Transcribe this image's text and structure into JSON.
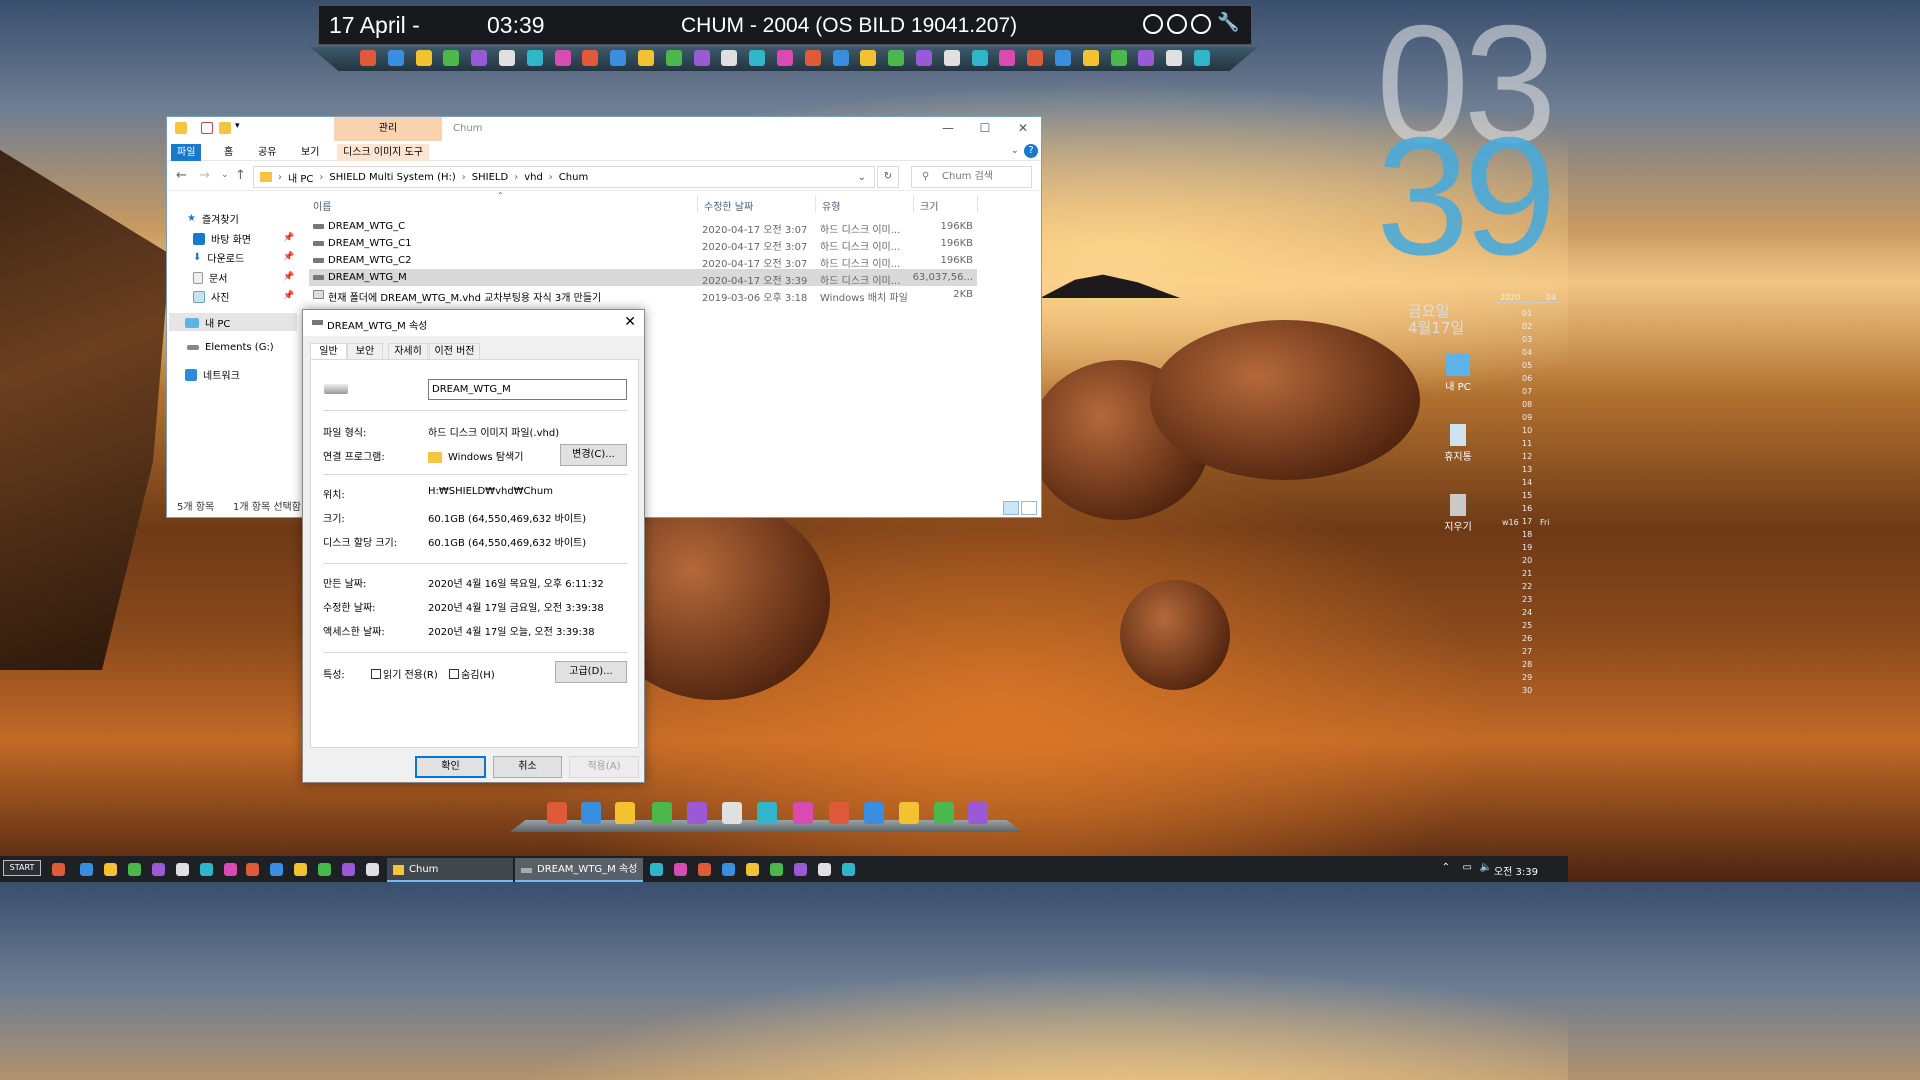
{
  "topbar": {
    "date": "17 April -",
    "time": "03:39",
    "title": "CHUM - 2004 (OS BILD 19041.207)"
  },
  "desktop": {
    "clock_hour": "03",
    "clock_minute": "39",
    "weekday": "금요일",
    "date": "4월17일",
    "calendar_year": "2020",
    "calendar_month": "04",
    "calendar_days": [
      "01",
      "02",
      "03",
      "04",
      "05",
      "06",
      "07",
      "08",
      "09",
      "10",
      "11",
      "12",
      "13",
      "14",
      "15",
      "16",
      "17",
      "18",
      "19",
      "20",
      "21",
      "22",
      "23",
      "24",
      "25",
      "26",
      "27",
      "28",
      "29",
      "30"
    ],
    "week_label": "w16",
    "today_day": "Fri",
    "icons": [
      {
        "label": "내 PC",
        "icon": "computer-icon"
      },
      {
        "label": "휴지통",
        "icon": "recycle-bin-icon"
      },
      {
        "label": "지우기",
        "icon": "broom-icon"
      }
    ]
  },
  "explorer": {
    "title": "Chum",
    "context_tab": "관리",
    "ribbon_tabs": [
      "파일",
      "홈",
      "공유",
      "보기",
      "디스크 이미지 도구"
    ],
    "breadcrumb": [
      "내 PC",
      "SHIELD Multi System (H:)",
      "SHIELD",
      "vhd",
      "Chum"
    ],
    "search_placeholder": "Chum 검색",
    "nav": {
      "quick_access": "즐겨찾기",
      "items": [
        "바탕 화면",
        "다운로드",
        "문서",
        "사진"
      ],
      "this_pc": "내 PC",
      "drive": "Elements (G:)",
      "network": "네트워크"
    },
    "columns": [
      "이름",
      "수정한 날짜",
      "유형",
      "크기"
    ],
    "files": [
      {
        "name": "DREAM_WTG_C",
        "date": "2020-04-17 오전 3:07",
        "type": "하드 디스크 이미...",
        "size": "196KB"
      },
      {
        "name": "DREAM_WTG_C1",
        "date": "2020-04-17 오전 3:07",
        "type": "하드 디스크 이미...",
        "size": "196KB"
      },
      {
        "name": "DREAM_WTG_C2",
        "date": "2020-04-17 오전 3:07",
        "type": "하드 디스크 이미...",
        "size": "196KB"
      },
      {
        "name": "DREAM_WTG_M",
        "date": "2020-04-17 오전 3:39",
        "type": "하드 디스크 이미...",
        "size": "63,037,56..."
      },
      {
        "name": "현재 폴더에 DREAM_WTG_M.vhd 교차부팅용 자식 3개 만들기",
        "date": "2019-03-06 오후 3:18",
        "type": "Windows 배치 파일",
        "size": "2KB"
      }
    ],
    "status_count": "5개 항목",
    "status_selected": "1개 항목 선택함"
  },
  "properties": {
    "title": "DREAM_WTG_M 속성",
    "tabs": [
      "일반",
      "보안",
      "자세히",
      "이전 버전"
    ],
    "name_value": "DREAM_WTG_M",
    "file_type_label": "파일 형식:",
    "file_type_value": "하드 디스크 이미지 파일(.vhd)",
    "open_with_label": "연결 프로그램:",
    "open_with_value": "Windows 탐색기",
    "change_button": "변경(C)...",
    "location_label": "위치:",
    "location_value": "H:₩SHIELD₩vhd₩Chum",
    "size_label": "크기:",
    "size_value": "60.1GB (64,550,469,632 바이트)",
    "size_on_disk_label": "디스크 할당 크기:",
    "size_on_disk_value": "60.1GB (64,550,469,632 바이트)",
    "created_label": "만든 날짜:",
    "created_value": "2020년 4월 16일 목요일, 오후 6:11:32",
    "modified_label": "수정한 날짜:",
    "modified_value": "2020년 4월 17일 금요일, 오전 3:39:38",
    "accessed_label": "액세스한 날짜:",
    "accessed_value": "2020년 4월 17일 오늘, 오전 3:39:38",
    "attributes_label": "특성:",
    "readonly_label": "읽기 전용(R)",
    "hidden_label": "숨김(H)",
    "advanced_button": "고급(D)...",
    "ok_button": "확인",
    "cancel_button": "취소",
    "apply_button": "적용(A)"
  },
  "taskbar": {
    "start_label": "START",
    "tasks": [
      "Chum",
      "DREAM_WTG_M 속성"
    ],
    "clock": "오전 3:39"
  },
  "colors": {
    "accent": "#1979ca",
    "clock_minute": "#46aadc",
    "context_tab": "#f9d2b0"
  }
}
